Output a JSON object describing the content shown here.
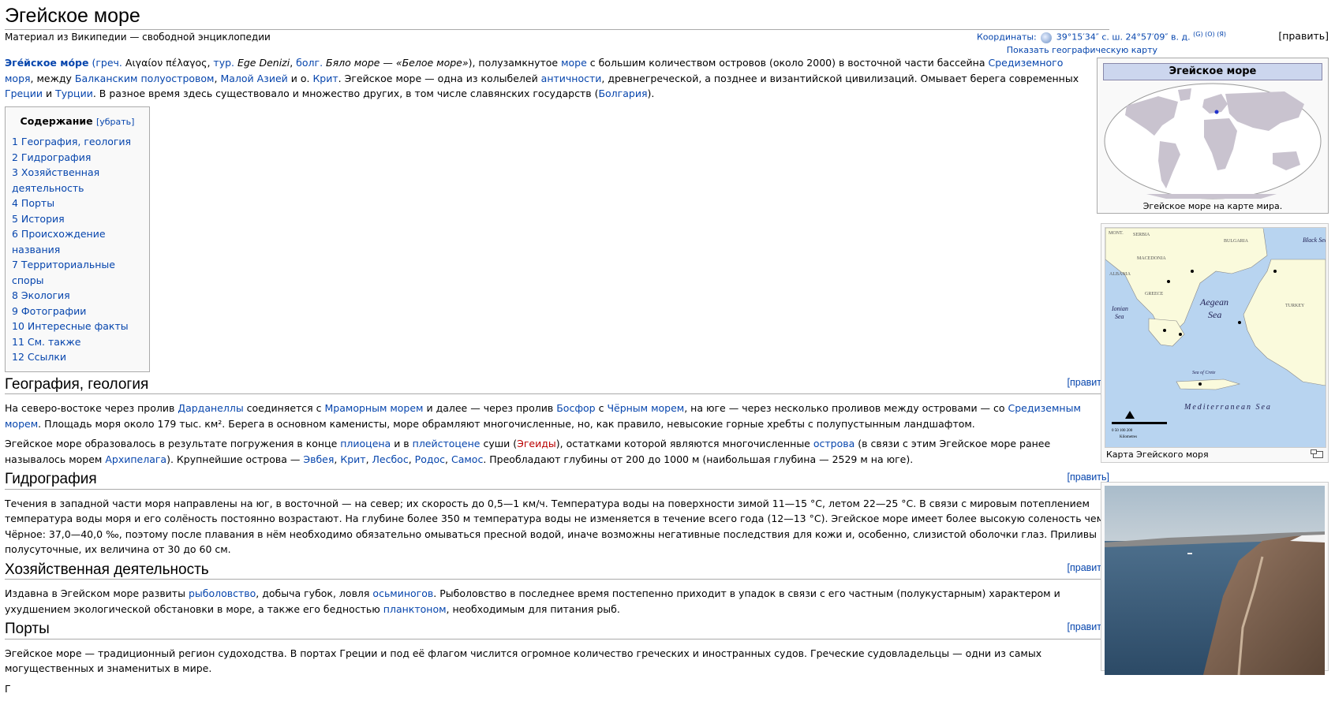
{
  "page": {
    "title": "Эгейское море",
    "subtitle": "Материал из Википедии — свободной энциклопедии",
    "edit_label": "[править]"
  },
  "coords": {
    "label": "Координаты:",
    "value": "39°15′34″ с. ш. 24°57′09″ в. д.",
    "sup": "(G) (O) (Я)",
    "show_map": "Показать географическую карту"
  },
  "intro": {
    "word_title": "Эге́йское мо́ре",
    "lang_open": "(",
    "lang_greek_abbr": "греч.",
    "greek": " Αιγαίον πέλαγος",
    "sep1": ", ",
    "lang_tur_abbr": "тур.",
    "tur": " Ege Denizi",
    "sep2": ", ",
    "lang_bul_abbr": "болг.",
    "bul": " Бяло море — «Белое море»",
    "lang_close": "), полузамкнутое ",
    "link_sea": "море",
    "t1": " с большим количеством островов (около 2000) в восточной части бассейна ",
    "link_med": "Средиземного моря",
    "t2": ", между ",
    "link_balkan": "Балканским полуостровом",
    "t3": ", ",
    "link_asia": "Малой Азией",
    "t4": " и о. ",
    "link_crete": "Крит",
    "t5": ". Эгейское море — одна из колыбелей ",
    "link_antiq": "античности",
    "t6": ", древнегреческой, а позднее и византийской цивилизаций. Омывает берега современных ",
    "link_greece": "Греции",
    "t7": " и ",
    "link_turkey": "Турции",
    "t8": ". В разное время здесь существовало и множество других, в том числе славянских государств (",
    "link_bulgaria": "Болгария",
    "t9": ")."
  },
  "toc": {
    "title": "Содержание",
    "toggle": "[убрать]",
    "items": [
      "1 География, геология",
      "2 Гидрография",
      "3 Хозяйственная деятельность",
      "4 Порты",
      "5 История",
      "6 Происхождение названия",
      "7 Территориальные споры",
      "8 Экология",
      "9 Фотографии",
      "10 Интересные факты",
      "11 См. также",
      "12 Ссылки"
    ]
  },
  "sections": {
    "geo": {
      "heading": "География, геология",
      "p1_a": "На северо-востоке через пролив ",
      "p1_l1": "Дарданеллы",
      "p1_b": " соединяется с ",
      "p1_l2": "Мраморным морем",
      "p1_c": " и далее — через пролив ",
      "p1_l3": "Босфор",
      "p1_d": " с ",
      "p1_l4": "Чёрным морем",
      "p1_e": ", на юге — через несколько проливов между островами — со ",
      "p1_l5": "Средиземным морем",
      "p1_f": ". Площадь моря около 179 тыс. км². Берега в основном каменисты, море обрамляют многочисленные, но, как правило, невысокие горные хребты с полупустынным ландшафтом.",
      "p2_a": "Эгейское море образовалось в результате погружения в конце ",
      "p2_l1": "плиоцена",
      "p2_b": " и в ",
      "p2_l2": "плейстоцене",
      "p2_c": " суши (",
      "p2_l3": "Эгеиды",
      "p2_d": "), остатками которой являются многочисленные ",
      "p2_l4": "острова",
      "p2_e": " (в связи с этим Эгейское море ранее называлось морем ",
      "p2_l5": "Архипелага",
      "p2_f": "). Крупнейшие острова — ",
      "p2_l6": "Эвбея",
      "p2_g": ", ",
      "p2_l7": "Крит",
      "p2_h": ", ",
      "p2_l8": "Лесбос",
      "p2_i": ", ",
      "p2_l9": "Родос",
      "p2_j": ", ",
      "p2_l10": "Самос",
      "p2_k": ". Преобладают глубины от 200 до 1000 м (наибольшая глубина — 2529 м на юге)."
    },
    "hydro": {
      "heading": "Гидрография",
      "p1": "Течения в западной части моря направлены на юг, в восточной — на север; их скорость до 0,5—1 км/ч. Температура воды на поверхности зимой 11—15 °C, летом 22—25 °C. В связи с мировым потеплением температура воды моря и его солёность постоянно возрастают. На глубине более 350 м температура воды не изменяется в течение всего года (12—13 °C). Эгейское море имеет более высокую соленость чем Чёрное: 37,0—40,0 ‰, поэтому после плавания в нём необходимо обязательно омываться пресной водой, иначе возможны негативные последствия для кожи и, особенно, слизистой оболочки глаз. Приливы полусуточные, их величина от 30 до 60 см."
    },
    "econ": {
      "heading": "Хозяйственная деятельность",
      "p1_a": "Издавна в Эгейском море развиты ",
      "p1_l1": "рыболовство",
      "p1_b": ", добыча губок, ловля ",
      "p1_l2": "осьминогов",
      "p1_c": ". Рыболовство в последнее время постепенно приходит в упадок в связи с его частным (полукустарным) характером и ухудшением экологической обстановки в море, а также его бедностью ",
      "p1_l3": "планктоном",
      "p1_d": ", необходимым для питания рыб."
    },
    "ports": {
      "heading": "Порты",
      "p1": "Эгейское море — традиционный регион судоходства. В портах Греции и под её флагом числится огромное количество греческих и иностранных судов. Греческие судовладельцы — одни из самых могущественных и знаменитых в мире.",
      "p2": "Г"
    }
  },
  "infobox": {
    "title": "Эгейское море",
    "caption": "Эгейское море на карте мира."
  },
  "map_thumb": {
    "caption": "Карта Эгейского моря",
    "labels": {
      "black_sea": "Black Sea",
      "aegean": "Aegean",
      "sea": "Sea",
      "ionian": "Ionian",
      "ionian_sea": "Sea",
      "med": "Mediterranean Sea",
      "crete_sea": "Sea of Crete",
      "turkey": "TURKEY",
      "greece": "GREECE",
      "bulgaria": "BULGARIA",
      "serbia": "SERBIA",
      "macedonia": "MACEDONIA",
      "albania": "ALBANIA",
      "mont": "MONT.",
      "scale": "0   50   100      200",
      "scale_unit": "Kilometres"
    }
  },
  "colors": {
    "link": "#0645ad",
    "redlink": "#ba0000",
    "land": "#c9c3cf",
    "sea_map": "#b8d4f0",
    "land_map": "#fafadc"
  }
}
